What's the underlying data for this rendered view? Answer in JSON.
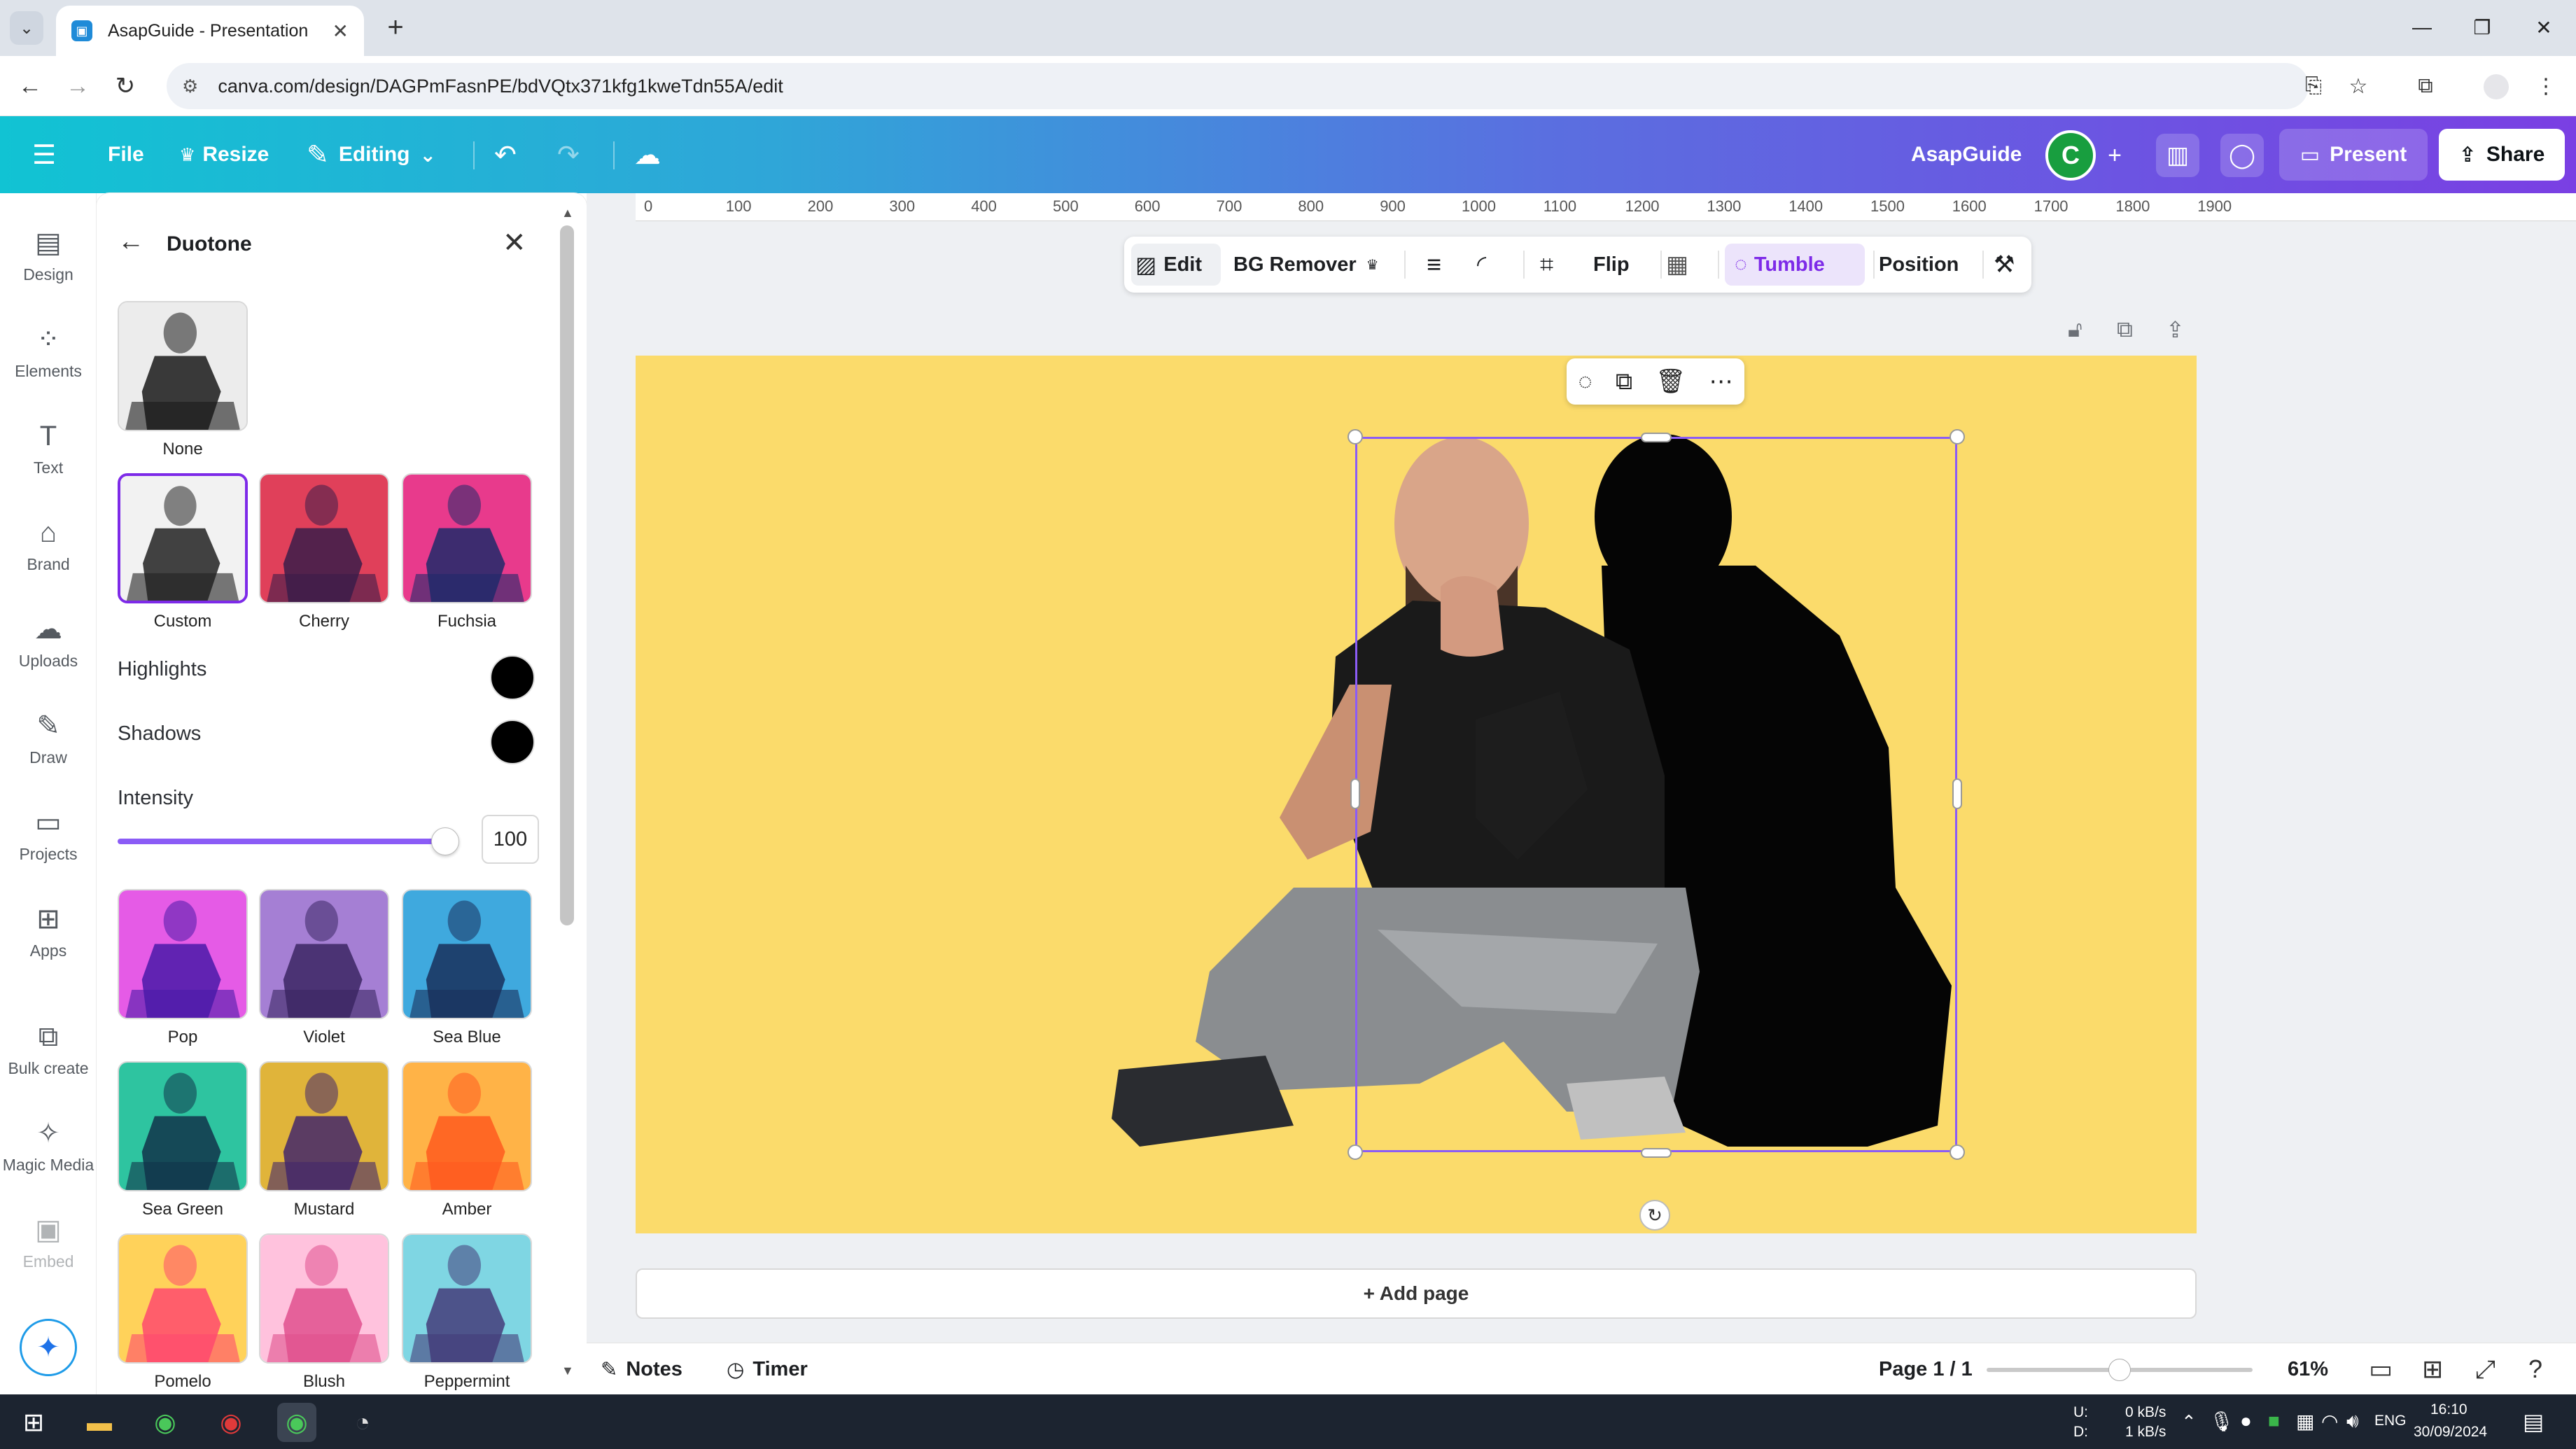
{
  "browser": {
    "tab_title": "AsapGuide - Presentation",
    "url": "canva.com/design/DAGPmFasnPE/bdVQtx371kfg1kweTdn55A/edit"
  },
  "header": {
    "file": "File",
    "resize": "Resize",
    "editing": "Editing",
    "team_name": "AsapGuide",
    "avatar_initial": "C",
    "present": "Present",
    "share": "Share"
  },
  "rail": {
    "items": [
      {
        "label": "Design",
        "icon": "layout-icon"
      },
      {
        "label": "Elements",
        "icon": "shapes-icon"
      },
      {
        "label": "Text",
        "icon": "text-icon"
      },
      {
        "label": "Brand",
        "icon": "brand-icon"
      },
      {
        "label": "Uploads",
        "icon": "cloud-upload-icon"
      },
      {
        "label": "Draw",
        "icon": "pen-icon"
      },
      {
        "label": "Projects",
        "icon": "folder-icon"
      },
      {
        "label": "Apps",
        "icon": "apps-icon"
      },
      {
        "label": "Bulk create",
        "icon": "bulk-icon"
      },
      {
        "label": "Magic Media",
        "icon": "magic-image-icon"
      },
      {
        "label": "Embed",
        "icon": "embed-icon"
      }
    ]
  },
  "panel": {
    "title": "Duotone",
    "none_label": "None",
    "top_presets": [
      {
        "label": "Custom",
        "light": "#f2f2f2",
        "dark": "#222222"
      },
      {
        "label": "Cherry",
        "light": "#e0405a",
        "dark": "#3a1d4a"
      },
      {
        "label": "Fuchsia",
        "light": "#e83a8c",
        "dark": "#1f2a6a"
      }
    ],
    "highlights_label": "Highlights",
    "highlights_color": "#000000",
    "shadows_label": "Shadows",
    "shadows_color": "#000000",
    "intensity_label": "Intensity",
    "intensity_value": "100",
    "presets": [
      {
        "label": "Pop",
        "light": "#e55be6",
        "dark": "#4a1aa8"
      },
      {
        "label": "Violet",
        "light": "#a57fd4",
        "dark": "#3b2663"
      },
      {
        "label": "Sea Blue",
        "light": "#3fa9de",
        "dark": "#19305c"
      },
      {
        "label": "Sea Green",
        "light": "#2ec4a0",
        "dark": "#10344a"
      },
      {
        "label": "Mustard",
        "light": "#e0b43a",
        "dark": "#43276b"
      },
      {
        "label": "Amber",
        "light": "#ffb347",
        "dark": "#ff5a1f"
      },
      {
        "label": "Pomelo",
        "light": "#ffd25a",
        "dark": "#ff4a6e"
      },
      {
        "label": "Blush",
        "light": "#ffc2dd",
        "dark": "#e0508e"
      },
      {
        "label": "Peppermint",
        "light": "#7fd6e3",
        "dark": "#443c7a"
      }
    ]
  },
  "ruler": [
    "0",
    "100",
    "200",
    "300",
    "400",
    "500",
    "600",
    "700",
    "800",
    "900",
    "1000",
    "1100",
    "1200",
    "1300",
    "1400",
    "1500",
    "1600",
    "1700",
    "1800",
    "1900"
  ],
  "context_toolbar": {
    "edit": "Edit",
    "bg_remover": "BG Remover",
    "flip": "Flip",
    "tumble": "Tumble",
    "position": "Position"
  },
  "canvas": {
    "background": "#fbdb6b",
    "add_page": "+ Add page"
  },
  "footer": {
    "notes": "Notes",
    "timer": "Timer",
    "page": "Page 1 / 1",
    "zoom": "61%"
  },
  "taskbar": {
    "net_up_label": "U:",
    "net_down_label": "D:",
    "net_up": "0 kB/s",
    "net_down": "1 kB/s",
    "lang": "ENG",
    "time": "16:10",
    "date": "30/09/2024"
  }
}
